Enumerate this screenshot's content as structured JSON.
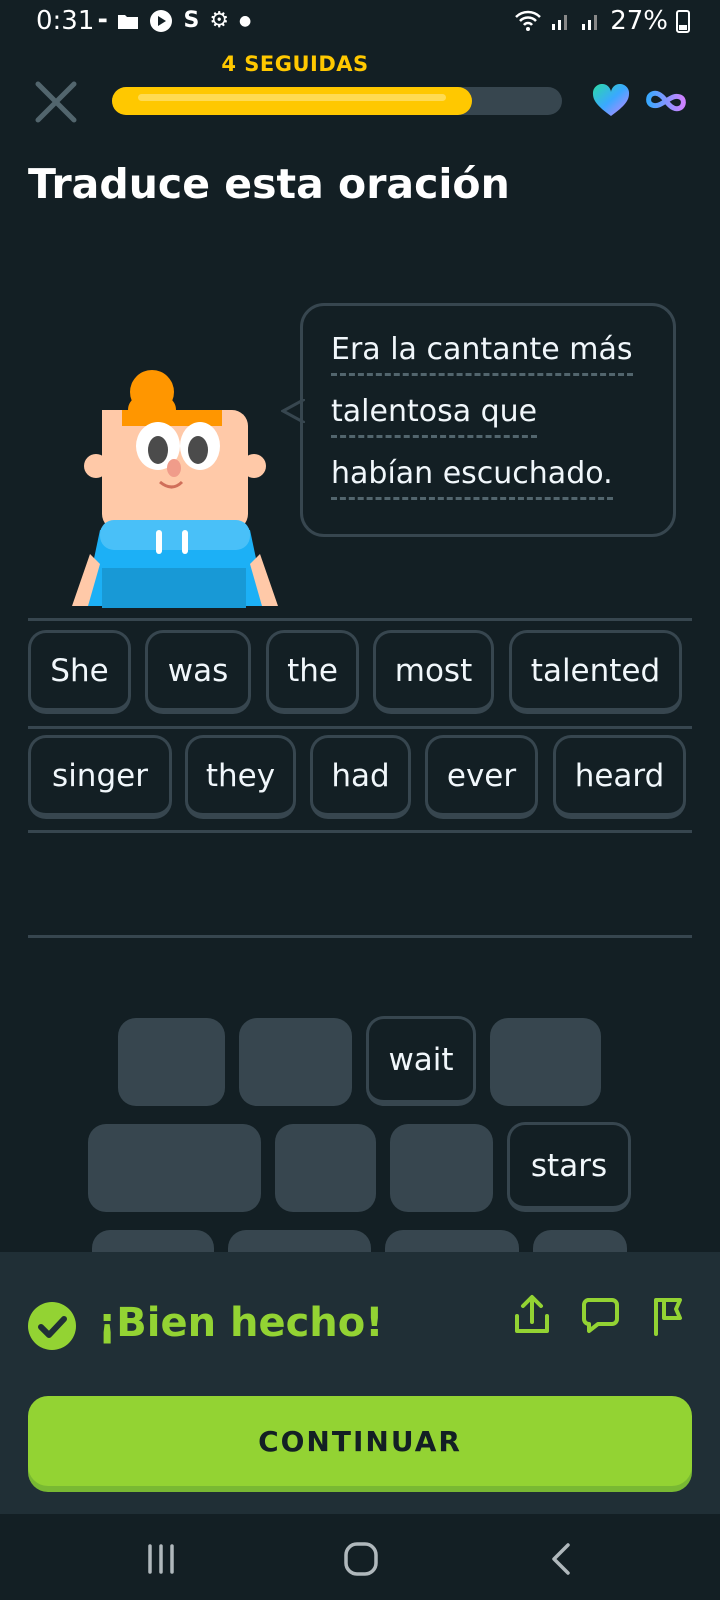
{
  "status_bar": {
    "time": "0:31",
    "battery": "27%",
    "icons_left": [
      "coursera-icon",
      "folder-icon",
      "play-icon",
      "s-icon",
      "gear-icon",
      "dot-icon"
    ],
    "icons_right": [
      "wifi-icon",
      "signal-icon",
      "signal-icon",
      "battery-icon"
    ]
  },
  "header": {
    "streak_label": "4 SEGUIDAS",
    "progress": 0.8,
    "hearts": "infinity",
    "accent_color": "#ffc800"
  },
  "title": "Traduce esta oración",
  "prompt": {
    "lines": [
      "Era la cantante más",
      "talentosa que",
      "habían escuchado."
    ]
  },
  "answer": {
    "row1": [
      "She",
      "was",
      "the",
      "most",
      "talented"
    ],
    "row2": [
      "singer",
      "they",
      "had",
      "ever",
      "heard"
    ]
  },
  "word_bank": {
    "visible_words": [
      "wait",
      "stars"
    ]
  },
  "feedback": {
    "message": "¡Bien hecho!",
    "success_color": "#93d333",
    "continue_label": "CONTINUAR"
  },
  "nav": [
    "recents-icon",
    "home-icon",
    "back-icon"
  ]
}
